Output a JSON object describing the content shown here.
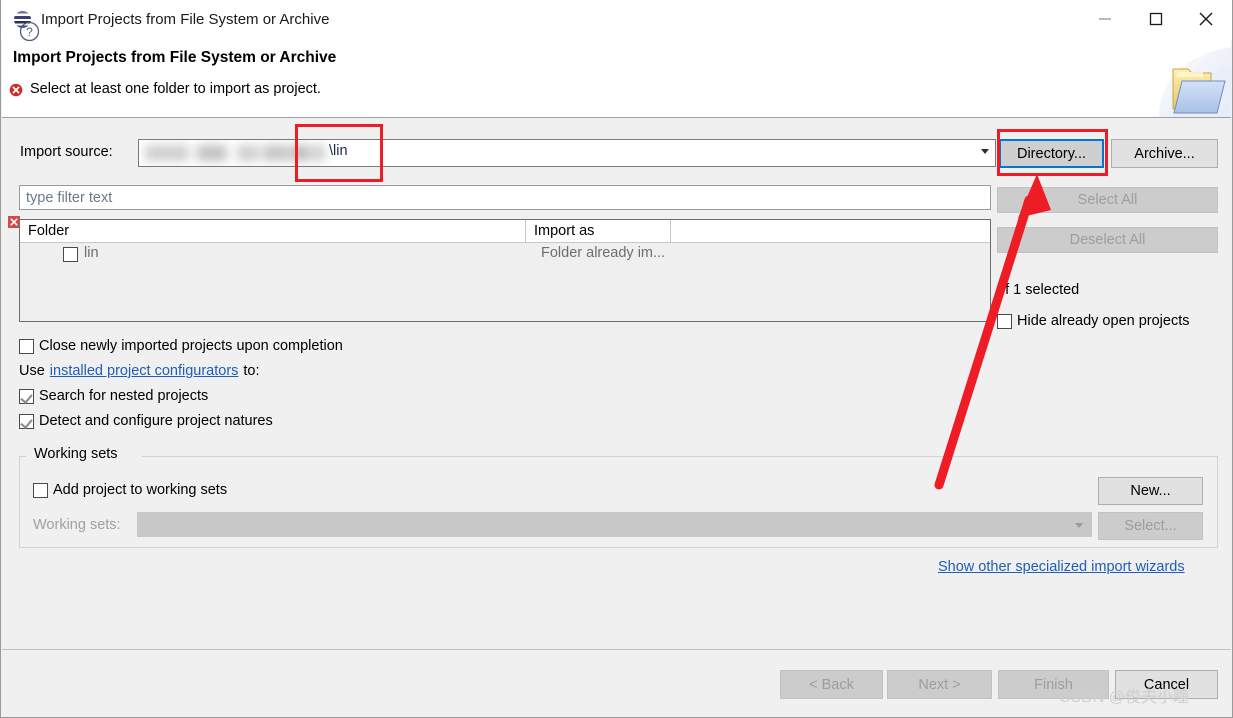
{
  "window": {
    "title": "Import Projects from File System or Archive",
    "app_icon": "eclipse-icon",
    "minimize_label": "—",
    "maximize_label": "□",
    "close_label": "✕"
  },
  "banner": {
    "title": "Import Projects from File System or Archive",
    "message": "Select at least one folder to import as project.",
    "error_icon": "error-icon",
    "graphic_icon": "open-folder-icon"
  },
  "import_source": {
    "label": "Import source:",
    "value": "\\lin",
    "blurred": true
  },
  "buttons": {
    "directory": "Directory...",
    "archive": "Archive...",
    "select_all": "Select All",
    "deselect_all": "Deselect All",
    "new": "New...",
    "select": "Select...",
    "back": "< Back",
    "next": "Next >",
    "finish": "Finish",
    "cancel": "Cancel"
  },
  "filter": {
    "placeholder": "type filter text",
    "value": ""
  },
  "tree": {
    "columns": [
      "Folder",
      "Import as",
      ""
    ],
    "rows": [
      {
        "folder": "lin",
        "import_as": "Folder already im...",
        "checked": false
      }
    ],
    "error_icon": "error-icon"
  },
  "selection": {
    "summary": "of 1 selected",
    "hide_already_open_label": "Hide already open projects",
    "hide_already_open_checked": false
  },
  "options": {
    "close_newly_imported": {
      "label": "Close newly imported projects upon completion",
      "checked": false
    },
    "use_prefix": "Use",
    "configurators_link": "installed project configurators",
    "use_suffix": "to:",
    "search_nested": {
      "label": "Search for nested projects",
      "checked": true
    },
    "detect_natures": {
      "label": "Detect and configure project natures",
      "checked": true
    }
  },
  "working_sets": {
    "legend": "Working sets",
    "add_label": "Add project to working sets",
    "add_checked": false,
    "combo_label": "Working sets:",
    "combo_value": ""
  },
  "links": {
    "other_wizards": "Show other specialized import wizards"
  },
  "help": {
    "icon": "help-icon"
  },
  "watermark": "CSDN @俊夫小瞳",
  "colors": {
    "accent_focus": "#0078d7",
    "annotation_red": "#ee1c25",
    "link_blue": "#1f5eb8",
    "error_red": "#cf2a2a",
    "dialog_bg": "#f0f0f0"
  }
}
